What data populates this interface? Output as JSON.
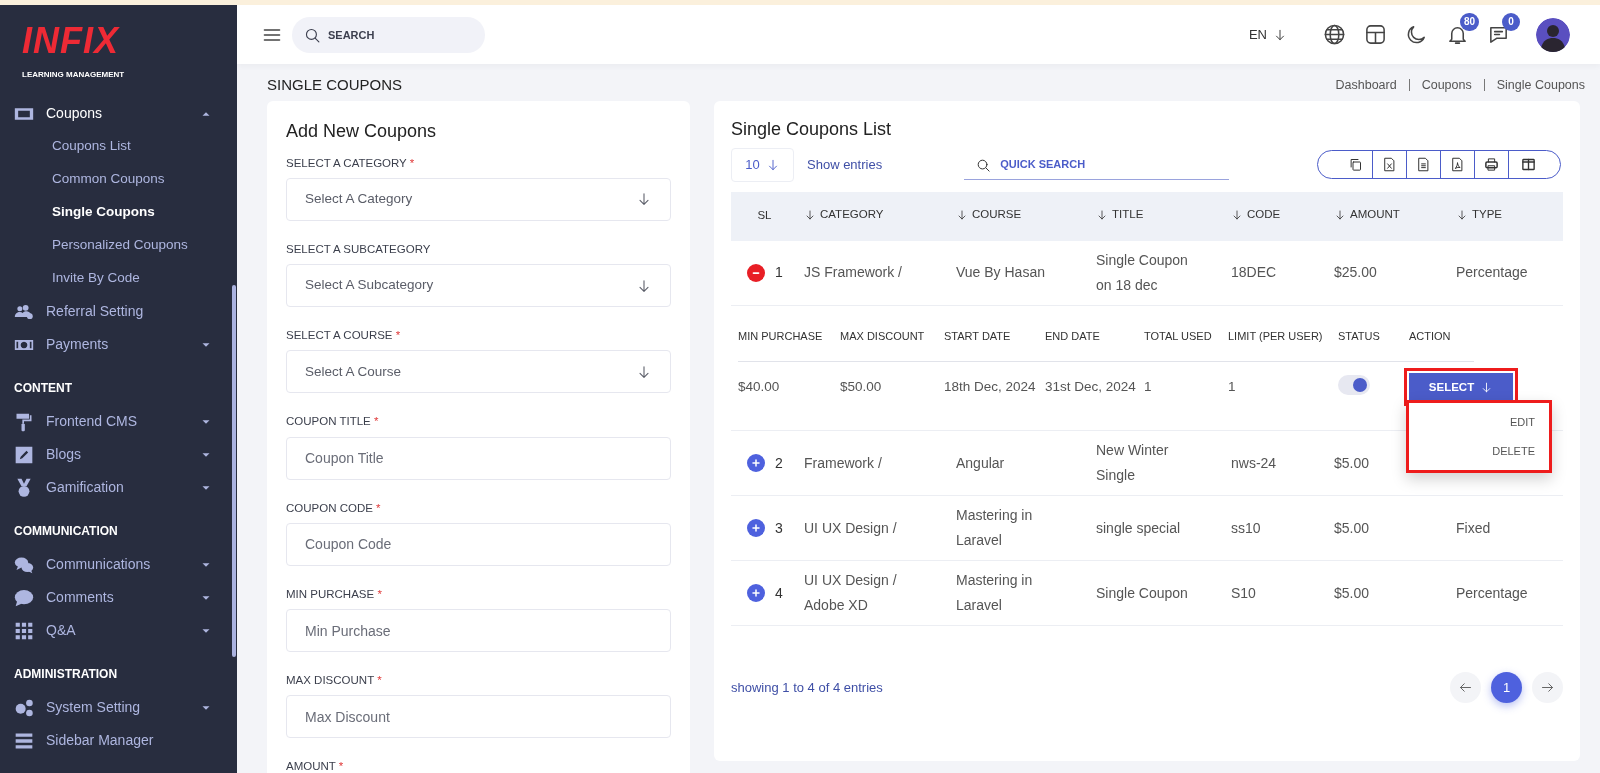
{
  "sidebar": {
    "logo": {
      "brand": "INFIX",
      "tagline": "LEARNING MANAGEMENT"
    },
    "items": [
      {
        "kind": "menu",
        "label": "Coupons",
        "expandable": true,
        "expanded": true,
        "children": [
          {
            "label": "Coupons List",
            "selected": false
          },
          {
            "label": "Common Coupons",
            "selected": false
          },
          {
            "label": "Single Coupons",
            "selected": true
          },
          {
            "label": "Personalized Coupons",
            "selected": false
          },
          {
            "label": "Invite By Code",
            "selected": false
          }
        ]
      },
      {
        "kind": "menu",
        "label": "Referral Setting",
        "expandable": false,
        "expanded": false
      },
      {
        "kind": "menu",
        "label": "Payments",
        "expandable": true,
        "expanded": false
      },
      {
        "kind": "section",
        "label": "CONTENT"
      },
      {
        "kind": "menu",
        "label": "Frontend CMS",
        "expandable": true,
        "expanded": false
      },
      {
        "kind": "menu",
        "label": "Blogs",
        "expandable": true,
        "expanded": false
      },
      {
        "kind": "menu",
        "label": "Gamification",
        "expandable": true,
        "expanded": false
      },
      {
        "kind": "section",
        "label": "COMMUNICATION"
      },
      {
        "kind": "menu",
        "label": "Communications",
        "expandable": true,
        "expanded": false
      },
      {
        "kind": "menu",
        "label": "Comments",
        "expandable": true,
        "expanded": false
      },
      {
        "kind": "menu",
        "label": "Q&A",
        "expandable": true,
        "expanded": false
      },
      {
        "kind": "section",
        "label": "ADMINISTRATION"
      },
      {
        "kind": "menu",
        "label": "System Setting",
        "expandable": true,
        "expanded": false
      },
      {
        "kind": "menu",
        "label": "Sidebar Manager",
        "expandable": false,
        "expanded": false
      }
    ]
  },
  "header": {
    "search": {
      "placeholder": "SEARCH"
    },
    "language": "EN",
    "notifications": "80",
    "messages": "0"
  },
  "page": {
    "title": "SINGLE COUPONS",
    "breadcrumbs": [
      "Dashboard",
      "Coupons",
      "Single Coupons"
    ]
  },
  "form": {
    "title": "Add New Coupons",
    "fields": [
      {
        "kind": "select",
        "label": "SELECT A CATEGORY",
        "required_mark": "*",
        "placeholder": "Select A Category"
      },
      {
        "kind": "select",
        "label": "SELECT A SUBCATEGORY",
        "placeholder": "Select A Subcategory"
      },
      {
        "kind": "select",
        "label": "SELECT A COURSE",
        "required_mark": "*",
        "placeholder": "Select A Course"
      },
      {
        "kind": "input",
        "label": "COUPON TITLE",
        "required_mark": "*",
        "placeholder": "Coupon Title"
      },
      {
        "kind": "input",
        "label": "COUPON CODE",
        "required_mark": "*",
        "placeholder": "Coupon Code"
      },
      {
        "kind": "input",
        "label": "MIN PURCHASE",
        "required_mark": "*",
        "placeholder": "Min Purchase"
      },
      {
        "kind": "input",
        "label": "MAX DISCOUNT",
        "required_mark": "*",
        "placeholder": "Max Discount"
      },
      {
        "kind": "label",
        "label": "AMOUNT",
        "required_mark": "*"
      }
    ]
  },
  "list": {
    "title": "Single Coupons List",
    "page_size": "10",
    "show_entries": "Show entries",
    "search": {
      "placeholder": "QUICK SEARCH"
    },
    "columns": [
      {
        "label": "SL",
        "sortable": false
      },
      {
        "label": "CATEGORY",
        "sortable": true
      },
      {
        "label": "COURSE",
        "sortable": true
      },
      {
        "label": "TITLE",
        "sortable": true
      },
      {
        "label": "CODE",
        "sortable": true
      },
      {
        "label": "AMOUNT",
        "sortable": true
      },
      {
        "label": "TYPE",
        "sortable": true
      }
    ],
    "rows": [
      {
        "expanded": true,
        "cells": [
          "1",
          "JS Framework /",
          "Vue By Hasan",
          "Single Coupon on 18 dec",
          "18DEC",
          "$25.00",
          "Percentage"
        ],
        "details": {
          "columns": [
            "MIN PURCHASE",
            "MAX DISCOUNT",
            "START DATE",
            "END DATE",
            "TOTAL USED",
            "LIMIT (PER USER)",
            "STATUS",
            "ACTION"
          ],
          "values": [
            "$40.00",
            "$50.00",
            "18th Dec, 2024",
            "31st Dec, 2024",
            "1",
            "1"
          ],
          "status_on": true,
          "action": {
            "label": "SELECT",
            "highlighted": true
          },
          "menu": {
            "highlighted": true,
            "items": [
              "EDIT",
              "DELETE"
            ]
          }
        }
      },
      {
        "expanded": false,
        "cells": [
          "2",
          "Framework /",
          "Angular",
          "New Winter Single",
          "nws-24",
          "$5.00"
        ]
      },
      {
        "expanded": false,
        "cells": [
          "3",
          "UI UX Design /",
          "Mastering in Laravel",
          "single special",
          "ss10",
          "$5.00",
          "Fixed"
        ]
      },
      {
        "expanded": false,
        "cells": [
          "4",
          "UI UX Design / Adobe XD",
          "Mastering in Laravel",
          "Single Coupon",
          "S10",
          "$5.00",
          "Percentage"
        ]
      }
    ],
    "info": "showing 1 to 4 of 4 entries",
    "pages": [
      {
        "label": "1",
        "selected": true
      }
    ]
  }
}
